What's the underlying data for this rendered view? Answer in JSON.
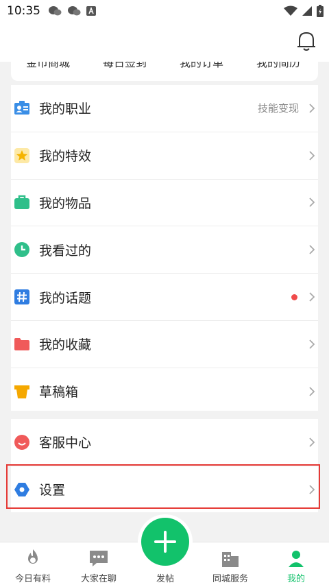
{
  "status": {
    "time": "10:35"
  },
  "quick_strip": {
    "items": [
      "金币商城",
      "每日签到",
      "我的订单",
      "我的简历"
    ]
  },
  "menu_main": [
    {
      "label": "我的职业",
      "hint": "技能变现"
    },
    {
      "label": "我的特效",
      "hint": ""
    },
    {
      "label": "我的物品",
      "hint": ""
    },
    {
      "label": "我看过的",
      "hint": ""
    },
    {
      "label": "我的话题",
      "hint": ""
    },
    {
      "label": "我的收藏",
      "hint": ""
    },
    {
      "label": "草稿箱",
      "hint": ""
    }
  ],
  "menu_secondary": [
    {
      "label": "客服中心"
    },
    {
      "label": "设置"
    }
  ],
  "tabbar": {
    "items": [
      "今日有料",
      "大家在聊",
      "发帖",
      "同城服务",
      "我的"
    ]
  },
  "colors": {
    "accent_green": "#12c26b",
    "highlight_red": "#e53935",
    "badge_red": "#f04b4b"
  }
}
